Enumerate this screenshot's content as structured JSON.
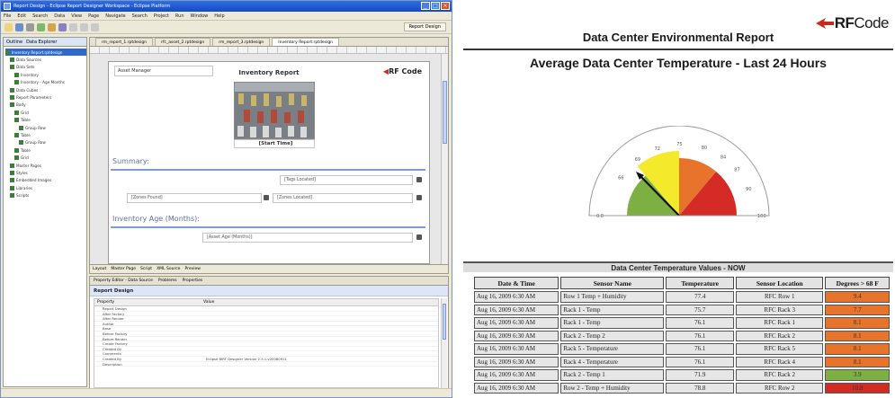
{
  "ide": {
    "window_title": "Report Design - Eclipse Report Designer Workspace - Eclipse Platform",
    "menu": [
      "File",
      "Edit",
      "Search",
      "Data",
      "View",
      "Page",
      "Navigate",
      "Search",
      "Project",
      "Run",
      "Window",
      "Help"
    ],
    "perspective_label": "Report Design",
    "left_pane_tabs": [
      "Outline",
      "Data Explorer"
    ],
    "outline_items": [
      "Inventory Report.rptdesign",
      "Data Sources",
      "Data Sets",
      "Inventory",
      "Inventory - Age Months",
      "Data Cubes",
      "Report Parameters",
      "Body",
      "Grid",
      "Table",
      "Group Row",
      "Table",
      "Group Row",
      "Table",
      "Grid",
      "Master Pages",
      "Styles",
      "Embedded Images",
      "Libraries",
      "Scripts"
    ],
    "editor_tabs": [
      "rm_report_1.rptdesign",
      "rfc_asset_2.rptdesign",
      "rm_report_3.rptdesign",
      "Inventory Report.rptdesign"
    ],
    "page": {
      "asset_manager_label": "Asset Manager",
      "report_title": "Inventory Report",
      "logo_text": "RF Code",
      "image_caption": "[Start Time]",
      "summary_label": "Summary:",
      "field_tags_located": "[Tags Located]",
      "field_zones_found": "[Zones Found]",
      "field_zones_located": "[Zones Located]",
      "age_label": "Inventory Age (Months):",
      "field_age": "[Asset Age (Months)]"
    },
    "editor_subtabs": [
      "Layout",
      "Master Page",
      "Script",
      "XML Source",
      "Preview"
    ],
    "props_tabs": [
      "Property Editor - Data Source",
      "Problems",
      "Properties"
    ],
    "props_header": "Report Design",
    "props_columns": [
      "Property",
      "Value"
    ],
    "props_rows": [
      {
        "k": "Report Design",
        "v": ""
      },
      {
        "k": "After Factory",
        "v": ""
      },
      {
        "k": "After Render",
        "v": ""
      },
      {
        "k": "Author",
        "v": ""
      },
      {
        "k": "Base",
        "v": ""
      },
      {
        "k": "Before Factory",
        "v": ""
      },
      {
        "k": "Before Render",
        "v": ""
      },
      {
        "k": "Create Factory",
        "v": ""
      },
      {
        "k": "Created By",
        "v": ""
      },
      {
        "k": "Comments",
        "v": ""
      },
      {
        "k": "Created By",
        "v": "Eclipse BIRT Designer Version 2.3.1.v20080911"
      },
      {
        "k": "Description",
        "v": ""
      }
    ],
    "status_text": ""
  },
  "report": {
    "logo_text_bold": "RF",
    "logo_text_regular": "Code",
    "title": "Data Center Environmental Report",
    "subtitle": "Average Data Center Temperature - Last 24 Hours",
    "gauge_labels": [
      "0.0",
      "66",
      "69",
      "72",
      "75",
      "80",
      "84",
      "87",
      "90",
      "100"
    ],
    "colors": {
      "green": "#7db043",
      "yellow": "#f4e92a",
      "orange": "#e8732a",
      "red": "#d52b25"
    },
    "table_title": "Data Center Temperature Values - NOW",
    "table_headers": [
      "Date & Time",
      "Sensor Name",
      "Temperature",
      "Sensor Location",
      "Degrees > 68 F"
    ],
    "table_rows": [
      {
        "date": "Aug 16, 2009 6:30 AM",
        "sensor": "Row 1 Temp + Humidity",
        "temp": "77.4",
        "location": "RFC Row 1",
        "deg": "9.4",
        "color": "#e8732a"
      },
      {
        "date": "Aug 16, 2009 6:30 AM",
        "sensor": "Rack 1 - Temp",
        "temp": "75.7",
        "location": "RFC Rack 3",
        "deg": "7.7",
        "color": "#e8732a"
      },
      {
        "date": "Aug 16, 2009 6:30 AM",
        "sensor": "Rack 1 - Temp",
        "temp": "76.1",
        "location": "RFC Rack 1",
        "deg": "8.1",
        "color": "#e8732a"
      },
      {
        "date": "Aug 16, 2009 6:30 AM",
        "sensor": "Rack 2 - Temp 2",
        "temp": "76.1",
        "location": "RFC Rack 2",
        "deg": "8.1",
        "color": "#e8732a"
      },
      {
        "date": "Aug 16, 2009 6:30 AM",
        "sensor": "Rack 5 - Temperature",
        "temp": "76.1",
        "location": "RFC Rack 5",
        "deg": "8.1",
        "color": "#e8732a"
      },
      {
        "date": "Aug 16, 2009 6:30 AM",
        "sensor": "Rack 4 - Temperature",
        "temp": "76.1",
        "location": "RFC Rack 4",
        "deg": "8.1",
        "color": "#e8732a"
      },
      {
        "date": "Aug 16, 2009 6:30 AM",
        "sensor": "Rack 2 - Temp 1",
        "temp": "71.9",
        "location": "RFC Rack 2",
        "deg": "3.9",
        "color": "#7db043"
      },
      {
        "date": "Aug 16, 2009 6:30 AM",
        "sensor": "Row 2 - Temp + Humidity",
        "temp": "78.8",
        "location": "RFC Row 2",
        "deg": "10.8",
        "color": "#d52b25"
      }
    ]
  }
}
